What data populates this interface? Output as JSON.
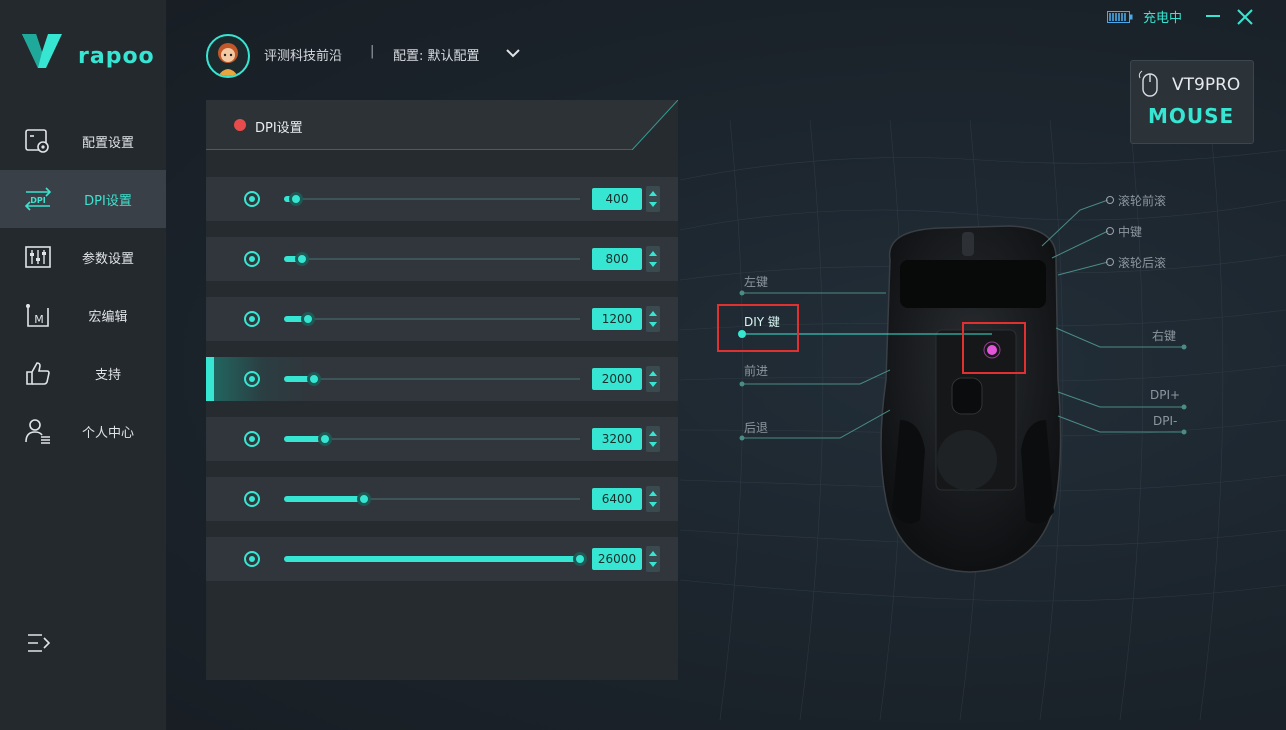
{
  "brand": {
    "name": "rapoo"
  },
  "sidebar": {
    "items": [
      {
        "label": "配置设置",
        "icon": "profile-settings-icon",
        "active": false
      },
      {
        "label": "DPI设置",
        "icon": "dpi-icon",
        "active": true
      },
      {
        "label": "参数设置",
        "icon": "sliders-icon",
        "active": false
      },
      {
        "label": "宏编辑",
        "icon": "macro-icon",
        "active": false
      },
      {
        "label": "支持",
        "icon": "thumbs-up-icon",
        "active": false
      },
      {
        "label": "个人中心",
        "icon": "user-icon",
        "active": false
      }
    ],
    "collapse_icon": "menu-collapse-icon"
  },
  "header": {
    "user_name": "评测科技前沿",
    "separator": "|",
    "profile_label": "配置: 默认配置"
  },
  "status": {
    "charging": "充电中"
  },
  "panel": {
    "title": "DPI设置"
  },
  "dpi_levels": [
    {
      "value": "400",
      "level": 0.04,
      "active": false
    },
    {
      "value": "800",
      "level": 0.06,
      "active": false
    },
    {
      "value": "1200",
      "level": 0.08,
      "active": false
    },
    {
      "value": "2000",
      "level": 0.1,
      "active": true
    },
    {
      "value": "3200",
      "level": 0.14,
      "active": false
    },
    {
      "value": "6400",
      "level": 0.27,
      "active": false
    },
    {
      "value": "26000",
      "level": 1.0,
      "active": false
    }
  ],
  "device": {
    "model": "VT9PRO",
    "type": "MOUSE"
  },
  "button_labels": {
    "scroll_forward": "滚轮前滚",
    "middle": "中键",
    "scroll_back": "滚轮后滚",
    "left": "左键",
    "diy": "DIY 键",
    "forward": "前进",
    "back": "后退",
    "right": "右键",
    "dpi_plus": "DPI+",
    "dpi_minus": "DPI-"
  },
  "colors": {
    "accent": "#37e6d2",
    "highlight_box": "#e03030",
    "panel": "#262b30"
  }
}
